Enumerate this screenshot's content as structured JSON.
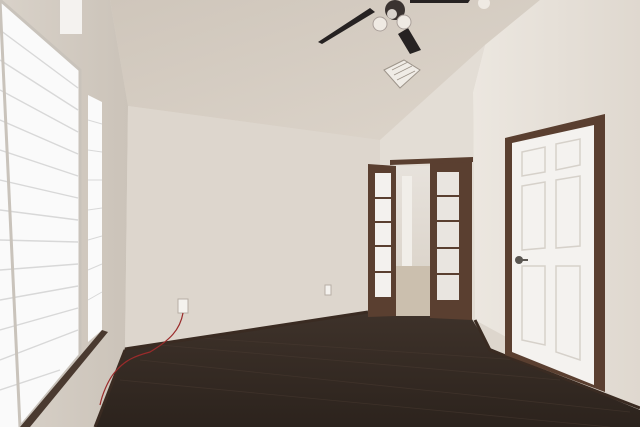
{
  "scene": {
    "kind": "photo",
    "subject": "empty-room-interior",
    "colors": {
      "ceiling": "#d8d0c6",
      "left_wall": "#d6cec4",
      "back_wall": "#ddd6cd",
      "right_wall": "#e6e0d8",
      "floor": "#3a2e27",
      "door_trim": "#5a3f30",
      "white_door": "#f3f1ee",
      "window_light": "#fbfbfb"
    }
  }
}
